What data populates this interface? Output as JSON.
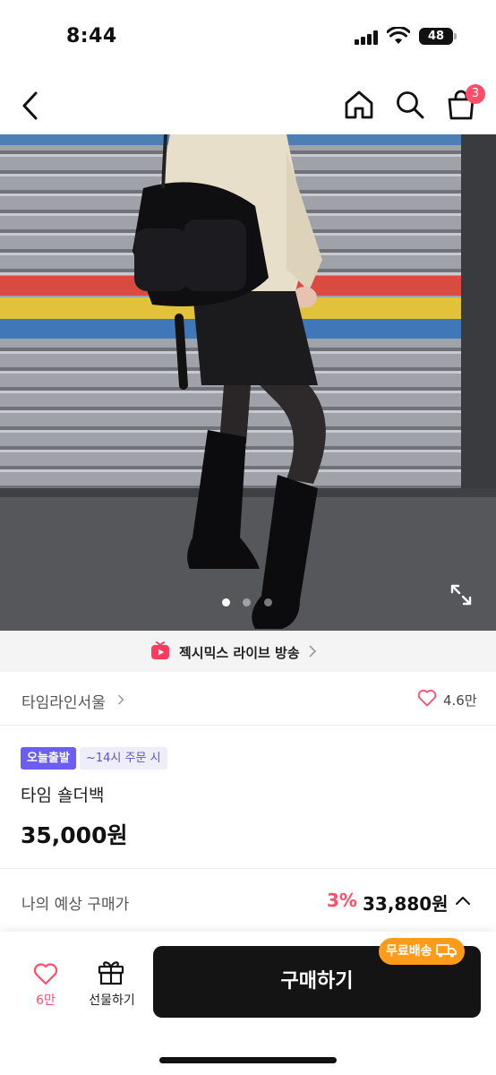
{
  "status_bar": {
    "time": "8:44",
    "battery": "48"
  },
  "header": {
    "back_icon": "chevron-left-icon",
    "home_icon": "home-icon",
    "search_icon": "search-icon",
    "cart_icon": "shopping-bag-icon",
    "cart_badge": "3"
  },
  "product_image": {
    "carousel_total": 3,
    "carousel_active": 1,
    "expand_icon": "expand-icon"
  },
  "live_banner": {
    "label": "젝시믹스 라이브 방송",
    "icon": "live-tv-icon"
  },
  "brand": {
    "name": "타임라인서울",
    "likes": "4.6만"
  },
  "product": {
    "badge_today": "오늘출발",
    "badge_cutoff": "~14시 주문 시",
    "title": "타임 숄더백",
    "price": "35,000원"
  },
  "expected_price": {
    "label": "나의 예상 구매가",
    "discount": "3%",
    "price": "33,880원"
  },
  "bottom_bar": {
    "like_count": "6만",
    "gift_label": "선물하기",
    "buy_label": "구매하기",
    "free_shipping": "무료배송"
  },
  "colors": {
    "accent_pink": "#ff4d6a",
    "badge_purple": "#6b5ef0",
    "free_ship_orange": "#ff9b1a",
    "buy_button": "#141414"
  }
}
